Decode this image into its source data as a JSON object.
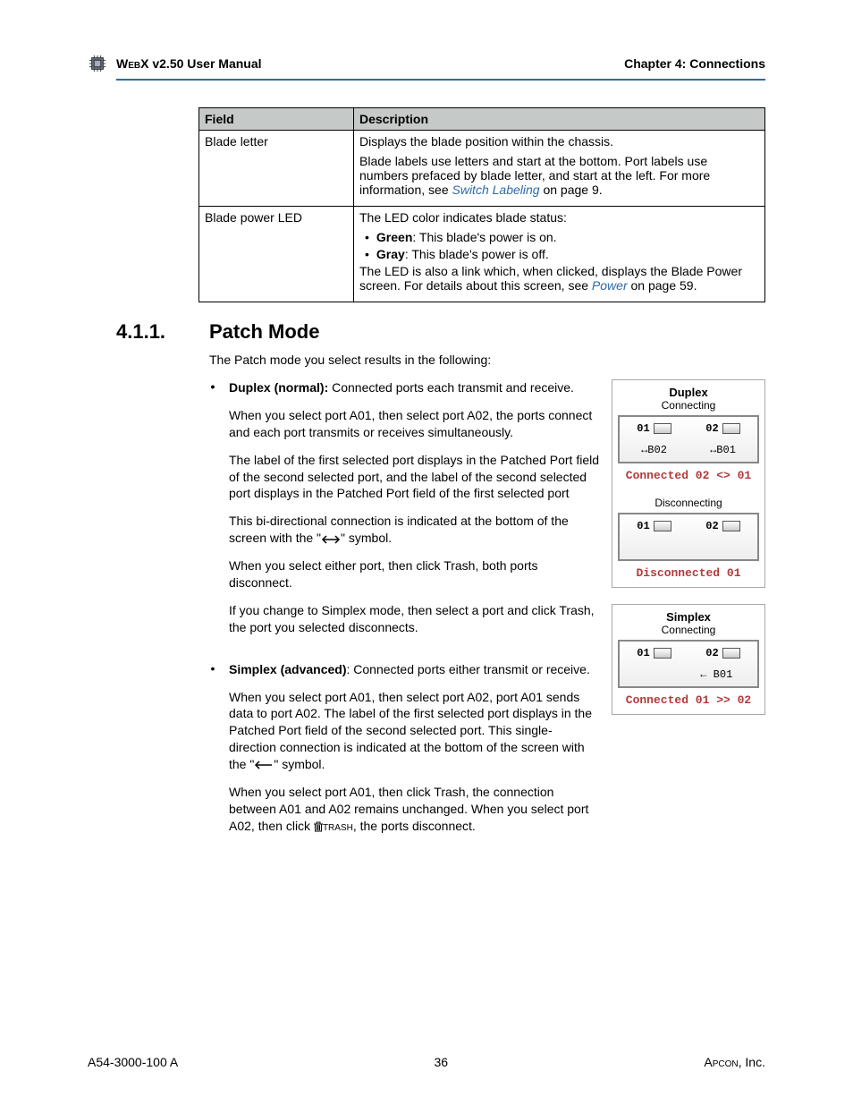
{
  "header": {
    "product": "WebX v2.50 User Manual",
    "chapter": "Chapter 4: Connections"
  },
  "table": {
    "col1": "Field",
    "col2": "Description",
    "rows": [
      {
        "field": "Blade letter",
        "desc": {
          "p1": "Displays the blade position within the chassis.",
          "p2_a": "Blade labels use letters and start at the bottom. Port labels use numbers prefaced by blade letter, and start at the left. For more information, see ",
          "p2_link": "Switch Labeling",
          "p2_b": " on page 9."
        }
      },
      {
        "field": "Blade power LED",
        "desc": {
          "p1": "The LED color indicates blade status:",
          "b1_strong": "Green",
          "b1_rest": ": This blade's power is on.",
          "b2_strong": "Gray",
          "b2_rest": ": This blade's power is off.",
          "p2_a": "The LED is also a link which, when clicked, displays the Blade Power screen. For details about this screen, see ",
          "p2_link": "Power",
          "p2_b": " on page 59."
        }
      }
    ]
  },
  "section": {
    "num": "4.1.1.",
    "title": "Patch Mode",
    "intro": "The Patch mode you select results in the following:"
  },
  "duplex": {
    "label_strong": "Duplex (normal):",
    "label_rest": " Connected ports each transmit and receive.",
    "p1": "When you select port A01, then select port A02, the ports connect and each port transmits or receives simultaneously.",
    "p2": "The label of the first selected port displays in the Patched Port field of the second selected port, and the label of the second selected port displays in the Patched Port field of the first selected port",
    "p3_a": "This bi-directional connection is indicated at the bottom of the screen with the \"",
    "p3_b": "\" symbol.",
    "p4": "When you select either port, then click Trash, both ports disconnect.",
    "p5": "If you change to Simplex mode, then select a port and click Trash, the port you selected disconnects."
  },
  "simplex": {
    "label_strong": "Simplex (advanced)",
    "label_rest": ": Connected ports either transmit or receive.",
    "p1_a": "When you select port A01, then select port A02, port A01 sends data to port A02. The label of the first selected port displays in the Patched Port field of the second selected port. This single-direction connection is indicated at the bottom of the screen with the \"",
    "p1_b": "\" symbol.",
    "p2_a": "When you select port A01, then click Trash, the connection between A01 and A02 remains unchanged. When you select port A02, then click ",
    "p2_trash": "trash",
    "p2_b": ", the ports disconnect."
  },
  "figs": {
    "duplex": {
      "title": "Duplex",
      "sub1": "Connecting",
      "ports": {
        "p1": "01",
        "p2": "02"
      },
      "patch": {
        "a": "↔B02",
        "b": "↔B01"
      },
      "status1": "Connected 02 <> 01",
      "sub2": "Disconnecting",
      "status2": "Disconnected 01"
    },
    "simplex": {
      "title": "Simplex",
      "sub1": "Connecting",
      "ports": {
        "p1": "01",
        "p2": "02"
      },
      "patch_b": "← B01",
      "status1": "Connected 01 >> 02"
    }
  },
  "footer": {
    "docnum": "A54-3000-100 A",
    "pagenum": "36",
    "company": "Apcon, Inc."
  }
}
